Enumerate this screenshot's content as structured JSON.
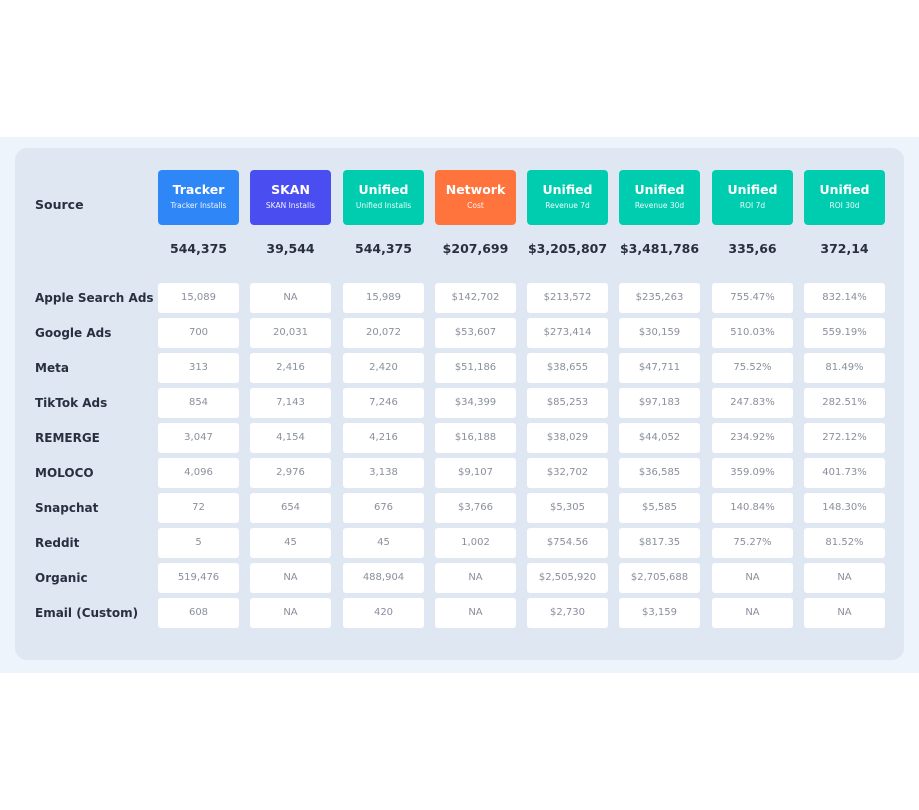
{
  "table": {
    "source_header": "Source",
    "columns": [
      {
        "title": "Tracker",
        "subtitle": "Tracker Installs",
        "color": "#2f86f6",
        "total": "544,375"
      },
      {
        "title": "SKAN",
        "subtitle": "SKAN Installs",
        "color": "#4a4ef0",
        "total": "39,544"
      },
      {
        "title": "Unified",
        "subtitle": "Unified Installs",
        "color": "#00cdb0",
        "total": "544,375"
      },
      {
        "title": "Network",
        "subtitle": "Cost",
        "color": "#ff743d",
        "total": "$207,699"
      },
      {
        "title": "Unified",
        "subtitle": "Revenue 7d",
        "color": "#00cdb0",
        "total": "$3,205,807"
      },
      {
        "title": "Unified",
        "subtitle": "Revenue 30d",
        "color": "#00cdb0",
        "total": "$3,481,786"
      },
      {
        "title": "Unified",
        "subtitle": "ROI 7d",
        "color": "#00cdb0",
        "total": "335,66"
      },
      {
        "title": "Unified",
        "subtitle": "ROI 30d",
        "color": "#00cdb0",
        "total": "372,14"
      }
    ],
    "rows": [
      {
        "source": "Apple Search Ads",
        "values": [
          "15,089",
          "NA",
          "15,989",
          "$142,702",
          "$213,572",
          "$235,263",
          "755.47%",
          "832.14%"
        ]
      },
      {
        "source": "Google Ads",
        "values": [
          "700",
          "20,031",
          "20,072",
          "$53,607",
          "$273,414",
          "$30,159",
          "510.03%",
          "559.19%"
        ]
      },
      {
        "source": "Meta",
        "values": [
          "313",
          "2,416",
          "2,420",
          "$51,186",
          "$38,655",
          "$47,711",
          "75.52%",
          "81.49%"
        ]
      },
      {
        "source": "TikTok Ads",
        "values": [
          "854",
          "7,143",
          "7,246",
          "$34,399",
          "$85,253",
          "$97,183",
          "247.83%",
          "282.51%"
        ]
      },
      {
        "source": "REMERGE",
        "values": [
          "3,047",
          "4,154",
          "4,216",
          "$16,188",
          "$38,029",
          "$44,052",
          "234.92%",
          "272.12%"
        ]
      },
      {
        "source": "MOLOCO",
        "values": [
          "4,096",
          "2,976",
          "3,138",
          "$9,107",
          "$32,702",
          "$36,585",
          "359.09%",
          "401.73%"
        ]
      },
      {
        "source": "Snapchat",
        "values": [
          "72",
          "654",
          "676",
          "$3,766",
          "$5,305",
          "$5,585",
          "140.84%",
          "148.30%"
        ]
      },
      {
        "source": "Reddit",
        "values": [
          "5",
          "45",
          "45",
          "1,002",
          "$754.56",
          "$817.35",
          "75.27%",
          "81.52%"
        ]
      },
      {
        "source": "Organic",
        "values": [
          "519,476",
          "NA",
          "488,904",
          "NA",
          "$2,505,920",
          "$2,705,688",
          "NA",
          "NA"
        ]
      },
      {
        "source": "Email (Custom)",
        "values": [
          "608",
          "NA",
          "420",
          "NA",
          "$2,730",
          "$3,159",
          "NA",
          "NA"
        ]
      }
    ]
  }
}
